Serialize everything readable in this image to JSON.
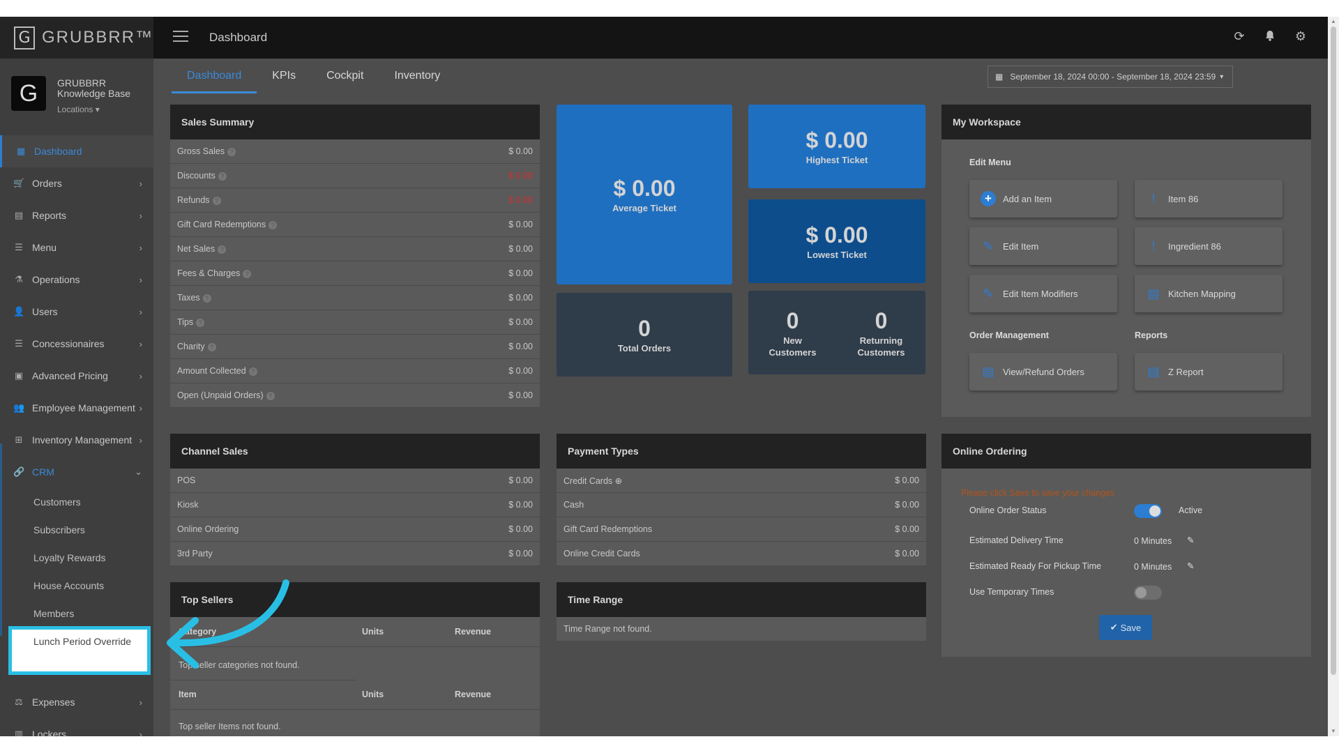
{
  "brand": {
    "logo_letter": "G",
    "name": "GRUBBRR™"
  },
  "topbar": {
    "title": "Dashboard",
    "icons": [
      "refresh-icon",
      "bell-icon",
      "gear-icon"
    ]
  },
  "profile": {
    "avatar_letter": "G",
    "org_line1": "GRUBBRR",
    "org_line2": "Knowledge Base",
    "locations": "Locations"
  },
  "sidebar": {
    "items": [
      {
        "label": "Dashboard",
        "icon": "dashboard-icon"
      },
      {
        "label": "Orders",
        "icon": "cart-icon"
      },
      {
        "label": "Reports",
        "icon": "report-icon"
      },
      {
        "label": "Menu",
        "icon": "menu-icon"
      },
      {
        "label": "Operations",
        "icon": "flask-icon"
      },
      {
        "label": "Users",
        "icon": "user-add-icon"
      },
      {
        "label": "Concessionaires",
        "icon": "list-icon"
      },
      {
        "label": "Advanced Pricing",
        "icon": "money-icon"
      },
      {
        "label": "Employee Management",
        "icon": "group-icon"
      },
      {
        "label": "Inventory Management",
        "icon": "sitemap-icon"
      },
      {
        "label": "CRM",
        "icon": "link-icon"
      },
      {
        "label": "Expenses",
        "icon": "scale-icon"
      },
      {
        "label": "Lockers",
        "icon": "lockers-icon"
      }
    ],
    "crm_sub": [
      "Customers",
      "Subscribers",
      "Loyalty Rewards",
      "House Accounts",
      "Members"
    ],
    "highlighted": "Lunch Period Override"
  },
  "tabs": [
    "Dashboard",
    "KPIs",
    "Cockpit",
    "Inventory"
  ],
  "daterange": "September 18, 2024 00:00 - September 18, 2024 23:59",
  "sales_summary": {
    "title": "Sales Summary",
    "rows": [
      {
        "label": "Gross Sales",
        "value": "$ 0.00",
        "red": false
      },
      {
        "label": "Discounts",
        "value": "$ 0.00",
        "red": true
      },
      {
        "label": "Refunds",
        "value": "$ 0.00",
        "red": true
      },
      {
        "label": "Gift Card Redemptions",
        "value": "$ 0.00",
        "red": false
      },
      {
        "label": "Net Sales",
        "value": "$ 0.00",
        "red": false
      },
      {
        "label": "Fees & Charges",
        "value": "$ 0.00",
        "red": false
      },
      {
        "label": "Taxes",
        "value": "$ 0.00",
        "red": false
      },
      {
        "label": "Tips",
        "value": "$ 0.00",
        "red": false
      },
      {
        "label": "Charity",
        "value": "$ 0.00",
        "red": false
      },
      {
        "label": "Amount Collected",
        "value": "$ 0.00",
        "red": false
      },
      {
        "label": "Open (Unpaid Orders)",
        "value": "$ 0.00",
        "red": false
      }
    ]
  },
  "tiles": {
    "average": {
      "value": "$ 0.00",
      "label": "Average Ticket"
    },
    "highest": {
      "value": "$ 0.00",
      "label": "Highest Ticket"
    },
    "lowest": {
      "value": "$ 0.00",
      "label": "Lowest Ticket"
    },
    "total_orders": {
      "value": "0",
      "label": "Total Orders"
    },
    "new_customers": {
      "value": "0",
      "label1": "New",
      "label2": "Customers"
    },
    "returning_customers": {
      "value": "0",
      "label1": "Returning",
      "label2": "Customers"
    }
  },
  "workspace": {
    "title": "My Workspace",
    "edit_menu": "Edit Menu",
    "order_management": "Order Management",
    "reports": "Reports",
    "buttons": {
      "add_item": "Add an Item",
      "item86": "Item 86",
      "edit_item": "Edit Item",
      "ingredient86": "Ingredient 86",
      "edit_modifiers": "Edit Item Modifiers",
      "kitchen_mapping": "Kitchen Mapping",
      "view_refund": "View/Refund Orders",
      "z_report": "Z Report"
    }
  },
  "channel_sales": {
    "title": "Channel Sales",
    "rows": [
      {
        "label": "POS",
        "value": "$ 0.00"
      },
      {
        "label": "Kiosk",
        "value": "$ 0.00"
      },
      {
        "label": "Online Ordering",
        "value": "$ 0.00"
      },
      {
        "label": "3rd Party",
        "value": "$ 0.00"
      }
    ]
  },
  "payment_types": {
    "title": "Payment Types",
    "rows": [
      {
        "label": "Credit Cards",
        "value": "$ 0.00"
      },
      {
        "label": "Cash",
        "value": "$ 0.00"
      },
      {
        "label": "Gift Card Redemptions",
        "value": "$ 0.00"
      },
      {
        "label": "Online Credit Cards",
        "value": "$ 0.00"
      }
    ]
  },
  "online_ordering": {
    "title": "Online Ordering",
    "message": "Please click Save to save your changes",
    "status_label": "Online Order Status",
    "status_value": "Active",
    "delivery_label": "Estimated Delivery Time",
    "delivery_value": "0 Minutes",
    "pickup_label": "Estimated Ready For Pickup Time",
    "pickup_value": "0 Minutes",
    "temp_label": "Use Temporary Times",
    "save": "Save"
  },
  "top_sellers": {
    "title": "Top Sellers",
    "col_category": "Category",
    "col_units": "Units",
    "col_revenue": "Revenue",
    "no_categories": "Top seller categories not found.",
    "col_item": "Item",
    "no_items": "Top seller Items not found."
  },
  "time_range": {
    "title": "Time Range",
    "empty": "Time Range not found."
  },
  "colors": {
    "accent": "#2d7dd2",
    "tile_blue": "#1f6fc0",
    "tile_navy": "#0d4d8c",
    "tile_dark": "#2f3c4a",
    "highlight": "#29bfe5"
  }
}
